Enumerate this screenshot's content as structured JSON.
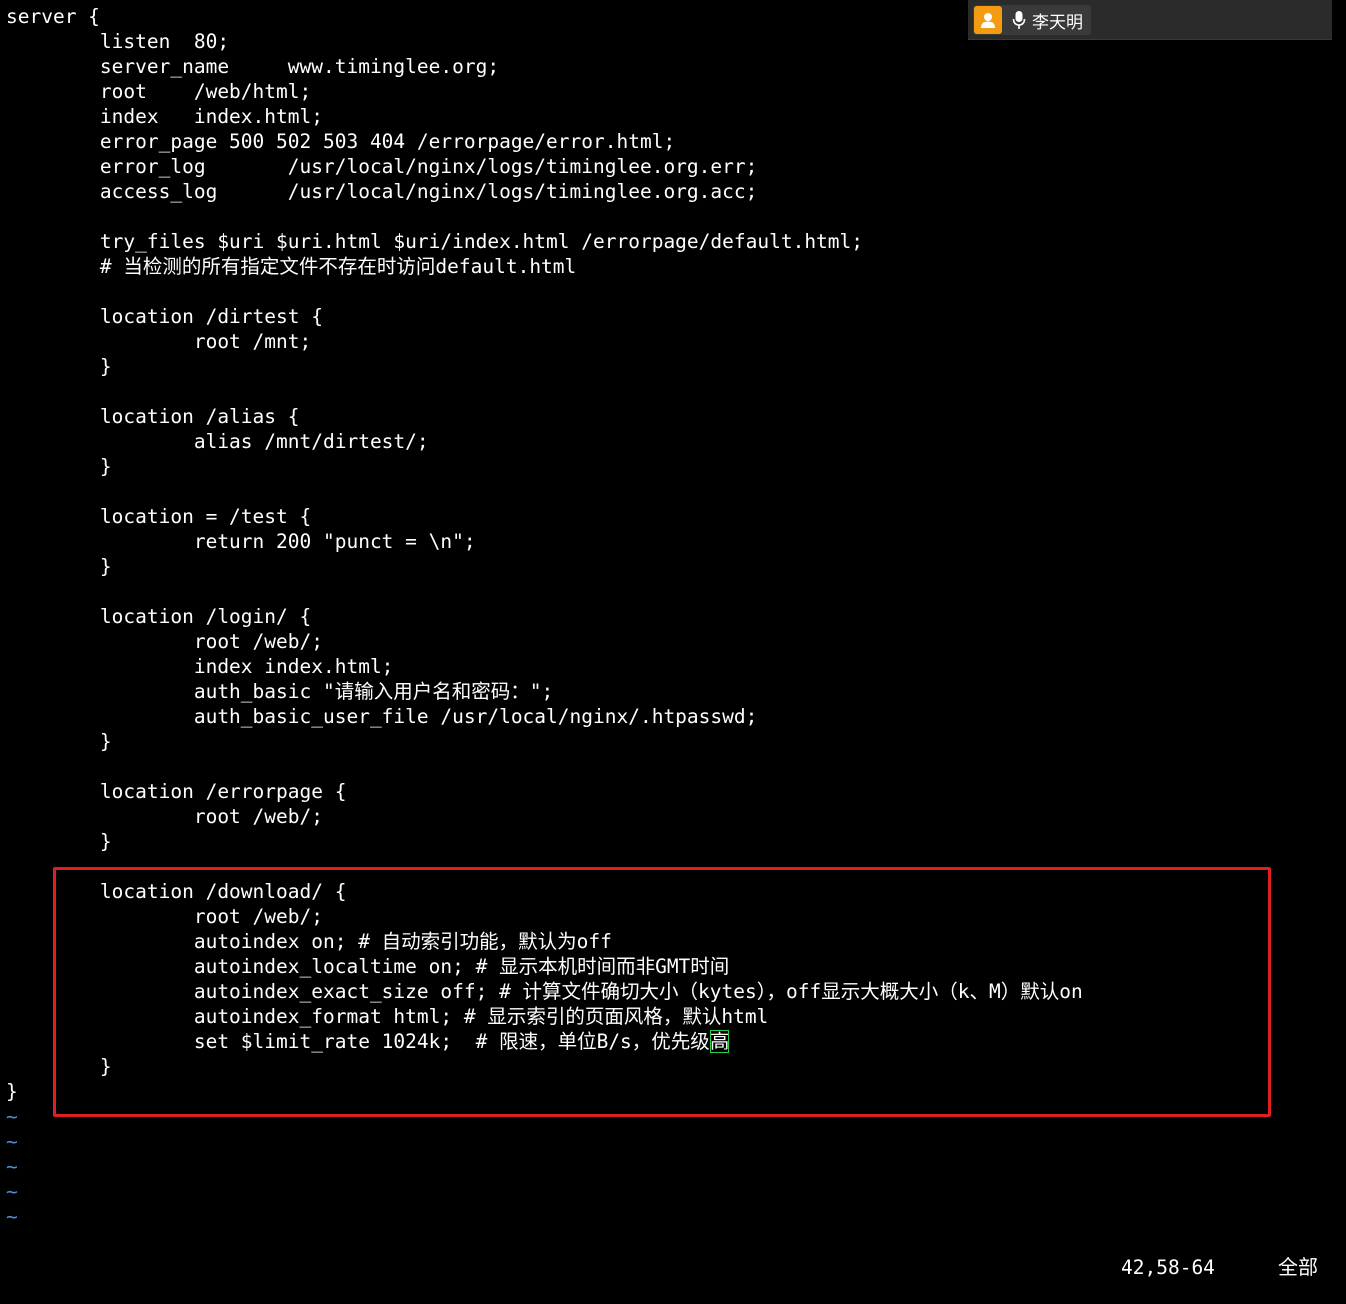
{
  "editor": {
    "lines": [
      "server {",
      "        listen  80;",
      "        server_name     www.timinglee.org;",
      "        root    /web/html;",
      "        index   index.html;",
      "        error_page 500 502 503 404 /errorpage/error.html;",
      "        error_log       /usr/local/nginx/logs/timinglee.org.err;",
      "        access_log      /usr/local/nginx/logs/timinglee.org.acc;",
      "",
      "        try_files $uri $uri.html $uri/index.html /errorpage/default.html;",
      "        # 当检测的所有指定文件不存在时访问default.html",
      "",
      "        location /dirtest {",
      "                root /mnt;",
      "        }",
      "",
      "        location /alias {",
      "                alias /mnt/dirtest/;",
      "        }",
      "",
      "        location = /test {",
      "                return 200 \"punct = \\n\";",
      "        }",
      "",
      "        location /login/ {",
      "                root /web/;",
      "                index index.html;",
      "                auth_basic \"请输入用户名和密码：\";",
      "                auth_basic_user_file /usr/local/nginx/.htpasswd;",
      "        }",
      "",
      "        location /errorpage {",
      "                root /web/;",
      "        }",
      "",
      "        location /download/ {",
      "                root /web/;",
      "                autoindex on; # 自动索引功能，默认为off",
      "                autoindex_localtime on; # 显示本机时间而非GMT时间",
      "                autoindex_exact_size off; # 计算文件确切大小（kytes），off显示大概大小（k、M）默认on",
      "                autoindex_format html; # 显示索引的页面风格，默认html",
      "                set $limit_rate 1024k;  # 限速，单位B/s，优先级",
      "        }",
      "}"
    ],
    "cursor_char": "高",
    "empty_line_marker": "~",
    "empty_lines_count": 5
  },
  "status": {
    "cursor_position": "42,58-64",
    "scroll_indicator": "全部"
  },
  "speaker_widget": {
    "name": "李天明"
  },
  "colors": {
    "background": "#000000",
    "text": "#ffffff",
    "tilde": "#4a8fd6",
    "highlight_box": "#e02020",
    "cursor": "#2ecc40",
    "avatar": "#f39c12"
  }
}
